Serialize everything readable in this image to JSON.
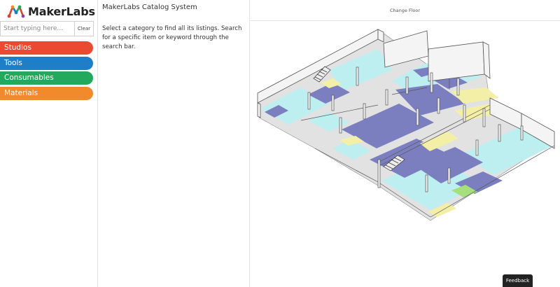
{
  "brand": {
    "name": "MakerLabs",
    "logo_icon": "makerlabs-logo-icon"
  },
  "search": {
    "placeholder": "Start typing here...",
    "value": "",
    "clear_label": "Clear"
  },
  "categories": [
    {
      "label": "Studios",
      "color": "#ea4a32"
    },
    {
      "label": "Tools",
      "color": "#1e7ec8"
    },
    {
      "label": "Consumables",
      "color": "#22a95d"
    },
    {
      "label": "Materials",
      "color": "#f08a2a"
    }
  ],
  "content": {
    "title": "MakerLabs Catalog System",
    "description": "Select a category to find all its listings. Search for a specific item or keyword through the search bar."
  },
  "map": {
    "change_floor_label": "Change Floor"
  },
  "feedback": {
    "label": "Feedback"
  },
  "colors": {
    "zone_cyan": "#bdeef0",
    "zone_navy": "#7b7fbf",
    "zone_yellow": "#f3efa6",
    "zone_green": "#a6e07c",
    "floor_gray": "#dcdcdc"
  }
}
